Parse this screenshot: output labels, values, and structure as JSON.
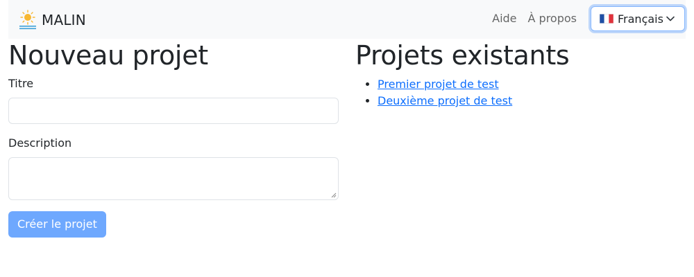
{
  "navbar": {
    "brand": "MALIN",
    "links": [
      "Aide",
      "À propos"
    ],
    "language": {
      "flag": "🇫🇷",
      "label": "Français"
    }
  },
  "new_project": {
    "heading": "Nouveau projet",
    "title_label": "Titre",
    "title_value": "",
    "description_label": "Description",
    "description_value": "",
    "submit_label": "Créer le projet"
  },
  "existing_projects": {
    "heading": "Projets existants",
    "items": [
      "Premier projet de test",
      "Deuxième projet de test"
    ]
  },
  "colors": {
    "primary_disabled": "#6ea8fe",
    "link": "#0d6efd",
    "navbar_bg": "#f8f9fa"
  }
}
